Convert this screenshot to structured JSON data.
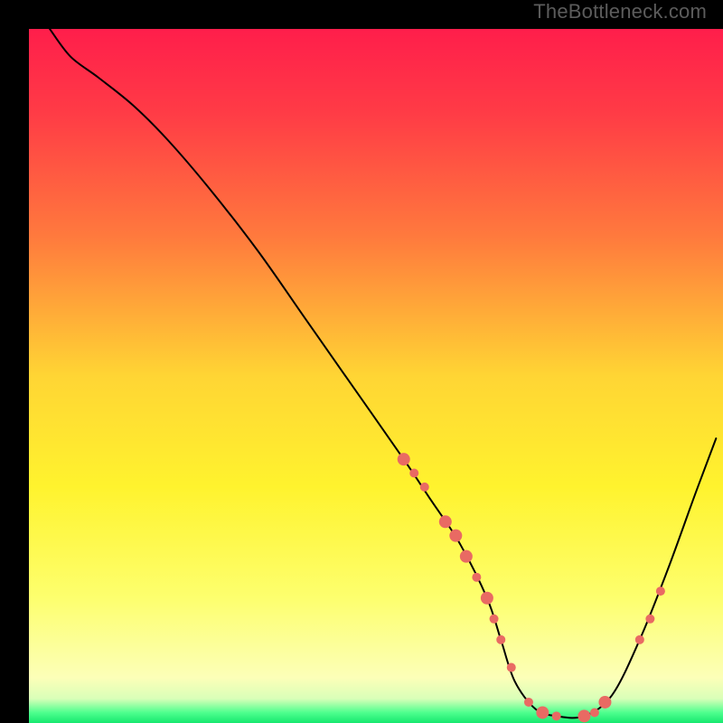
{
  "watermark": "TheBottleneck.com",
  "chart_data": {
    "type": "line",
    "title": "",
    "xlabel": "",
    "ylabel": "",
    "xlim": [
      0,
      100
    ],
    "ylim": [
      0,
      100
    ],
    "gradient_stops": [
      {
        "offset": 0.0,
        "color": "#ff1e4b"
      },
      {
        "offset": 0.12,
        "color": "#ff3b46"
      },
      {
        "offset": 0.3,
        "color": "#ff7a3d"
      },
      {
        "offset": 0.5,
        "color": "#ffd534"
      },
      {
        "offset": 0.66,
        "color": "#fff32e"
      },
      {
        "offset": 0.82,
        "color": "#fdff6e"
      },
      {
        "offset": 0.935,
        "color": "#fcffb8"
      },
      {
        "offset": 0.965,
        "color": "#d9ffb8"
      },
      {
        "offset": 0.985,
        "color": "#4eff8e"
      },
      {
        "offset": 1.0,
        "color": "#17e86f"
      }
    ],
    "series": [
      {
        "name": "bottleneck-curve",
        "x": [
          3,
          6,
          10,
          15,
          20,
          26,
          33,
          40,
          47,
          54,
          58,
          62,
          66,
          68,
          70,
          73,
          76,
          80,
          84,
          88,
          92,
          96,
          99
        ],
        "y": [
          100,
          96,
          93,
          89,
          84,
          77,
          68,
          58,
          48,
          38,
          32,
          26,
          18,
          12,
          6,
          2,
          1,
          1,
          4,
          12,
          22,
          33,
          41
        ],
        "stroke": "#000000",
        "stroke_width": 2
      }
    ],
    "markers": {
      "name": "highlight-dots",
      "color": "#e96a63",
      "radius_small": 5,
      "radius_large": 7,
      "points": [
        {
          "x": 54,
          "y": 38,
          "r": 7
        },
        {
          "x": 55.5,
          "y": 36,
          "r": 5
        },
        {
          "x": 57,
          "y": 34,
          "r": 5
        },
        {
          "x": 60,
          "y": 29,
          "r": 7
        },
        {
          "x": 61.5,
          "y": 27,
          "r": 7
        },
        {
          "x": 63,
          "y": 24,
          "r": 7
        },
        {
          "x": 64.5,
          "y": 21,
          "r": 5
        },
        {
          "x": 66,
          "y": 18,
          "r": 7
        },
        {
          "x": 67,
          "y": 15,
          "r": 5
        },
        {
          "x": 68,
          "y": 12,
          "r": 5
        },
        {
          "x": 69.5,
          "y": 8,
          "r": 5
        },
        {
          "x": 72,
          "y": 3,
          "r": 5
        },
        {
          "x": 74,
          "y": 1.5,
          "r": 7
        },
        {
          "x": 76,
          "y": 1,
          "r": 5
        },
        {
          "x": 80,
          "y": 1,
          "r": 7
        },
        {
          "x": 81.5,
          "y": 1.5,
          "r": 5
        },
        {
          "x": 83,
          "y": 3,
          "r": 7
        },
        {
          "x": 88,
          "y": 12,
          "r": 5
        },
        {
          "x": 89.5,
          "y": 15,
          "r": 5
        },
        {
          "x": 91,
          "y": 19,
          "r": 5
        }
      ]
    }
  }
}
